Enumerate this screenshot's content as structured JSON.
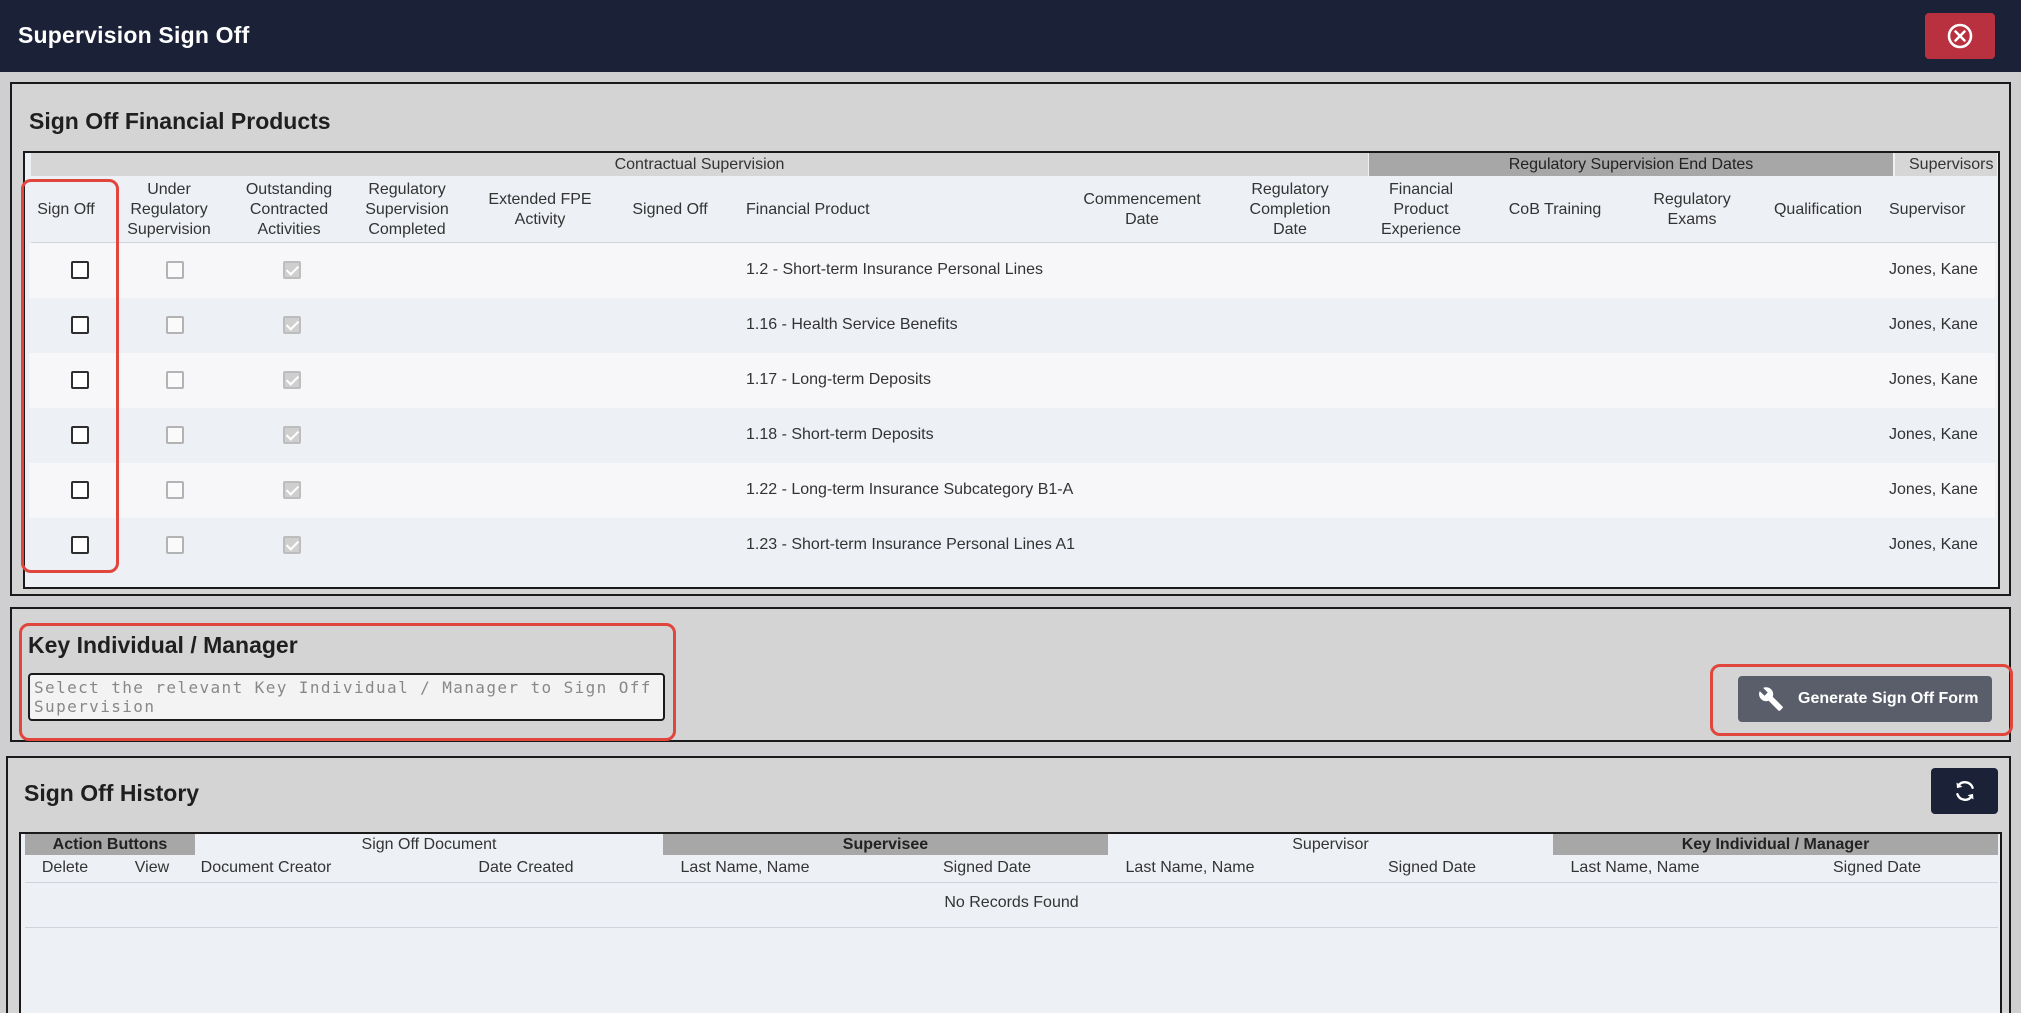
{
  "window": {
    "title": "Supervision Sign Off"
  },
  "products_section": {
    "title": "Sign Off Financial Products",
    "groups": {
      "contractual": "Contractual Supervision",
      "regulatory_end": "Regulatory Supervision End Dates",
      "supervisors": "Supervisors"
    },
    "columns": {
      "sign_off": "Sign Off",
      "under_reg": "Under Regulatory Supervision",
      "outstanding": "Outstanding Contracted Activities",
      "reg_completed": "Regulatory Supervision Completed",
      "extended_fpe": "Extended FPE Activity",
      "signed_off": "Signed Off",
      "financial_product": "Financial Product",
      "commencement": "Commencement Date",
      "reg_completion": "Regulatory Completion Date",
      "fin_experience": "Financial Product Experience",
      "cob_training": "CoB Training",
      "reg_exams": "Regulatory Exams",
      "qualification": "Qualification",
      "supervisor": "Supervisor"
    },
    "rows": [
      {
        "product": "1.2 - Short-term Insurance Personal Lines",
        "supervisor": "Jones, Kane"
      },
      {
        "product": "1.16 - Health Service Benefits",
        "supervisor": "Jones, Kane"
      },
      {
        "product": "1.17 - Long-term Deposits",
        "supervisor": "Jones, Kane"
      },
      {
        "product": "1.18 - Short-term Deposits",
        "supervisor": "Jones, Kane"
      },
      {
        "product": "1.22 - Long-term Insurance Subcategory B1-A",
        "supervisor": "Jones, Kane"
      },
      {
        "product": "1.23 - Short-term Insurance Personal Lines A1",
        "supervisor": "Jones, Kane"
      }
    ]
  },
  "key_individual": {
    "title": "Key Individual / Manager",
    "placeholder": "Select the relevant Key Individual / Manager to Sign Off Supervision",
    "generate_label": "Generate Sign Off Form"
  },
  "history": {
    "title": "Sign Off History",
    "groups": {
      "action_buttons": "Action Buttons",
      "sign_off_document": "Sign Off Document",
      "supervisee": "Supervisee",
      "supervisor": "Supervisor",
      "key_individual": "Key Individual / Manager"
    },
    "columns": {
      "delete": "Delete",
      "view": "View",
      "document_creator": "Document Creator",
      "date_created": "Date Created",
      "supervisee_name": "Last Name, Name",
      "supervisee_date": "Signed Date",
      "supervisor_name": "Last Name, Name",
      "supervisor_date": "Signed Date",
      "ki_name": "Last Name, Name",
      "ki_date": "Signed Date"
    },
    "empty": "No Records Found"
  },
  "colors": {
    "titlebar": "#1b2238",
    "close": "#b9303f",
    "highlight": "#e0463c",
    "button": "#5a5e6b"
  }
}
